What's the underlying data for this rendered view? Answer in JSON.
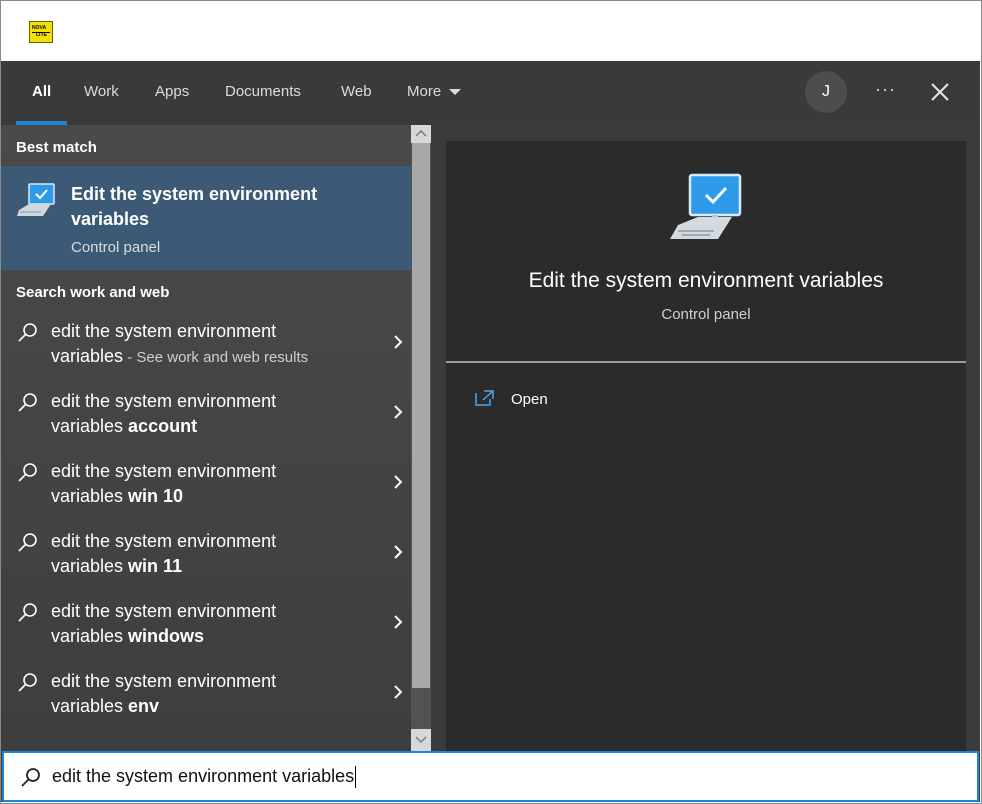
{
  "tabs": [
    {
      "label": "All"
    },
    {
      "label": "Work"
    },
    {
      "label": "Apps"
    },
    {
      "label": "Documents"
    },
    {
      "label": "Web"
    },
    {
      "label": "More"
    }
  ],
  "avatar_initial": "J",
  "more_options_glyph": "···",
  "best_match": {
    "section_label": "Best match",
    "title": "Edit the system environment variables",
    "subtitle": "Control panel",
    "icon": "monitor-check-icon"
  },
  "search_section_label": "Search work and web",
  "suggestions": [
    {
      "prefix": "edit the system environment",
      "line2_plain": "variables",
      "line2_bold": "",
      "hint": " - See work and web results"
    },
    {
      "prefix": "edit the system environment",
      "line2_plain": "variables ",
      "line2_bold": "account",
      "hint": ""
    },
    {
      "prefix": "edit the system environment",
      "line2_plain": "variables ",
      "line2_bold": "win 10",
      "hint": ""
    },
    {
      "prefix": "edit the system environment",
      "line2_plain": "variables ",
      "line2_bold": "win 11",
      "hint": ""
    },
    {
      "prefix": "edit the system environment",
      "line2_plain": "variables ",
      "line2_bold": "windows",
      "hint": ""
    },
    {
      "prefix": "edit the system environment",
      "line2_plain": "variables ",
      "line2_bold": "env",
      "hint": ""
    }
  ],
  "preview": {
    "title": "Edit the system environment variables",
    "subtitle": "Control panel",
    "action_open": "Open"
  },
  "search": {
    "value": "edit the system environment variables"
  },
  "colors": {
    "accent": "#1a86d9",
    "selected_bg": "#3c5a75",
    "logo_yellow": "#f3e000"
  }
}
